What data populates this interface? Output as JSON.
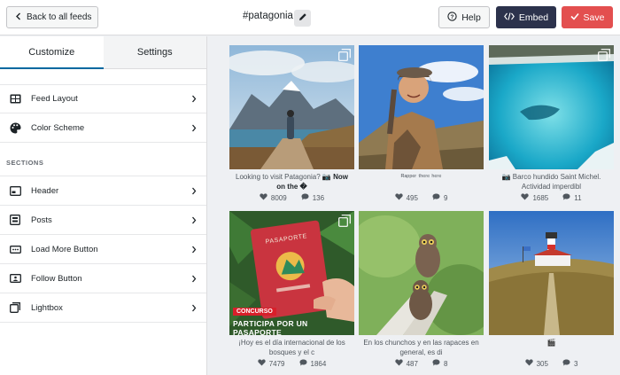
{
  "header": {
    "back_label": "Back to all feeds",
    "feed_title": "#patagonia",
    "help_label": "Help",
    "embed_label": "Embed",
    "save_label": "Save"
  },
  "sidebar": {
    "tabs": [
      {
        "label": "Customize",
        "active": true
      },
      {
        "label": "Settings",
        "active": false
      }
    ],
    "top_items": [
      {
        "label": "Feed Layout",
        "icon": "layout-icon"
      },
      {
        "label": "Color Scheme",
        "icon": "palette-icon"
      }
    ],
    "sections_label": "SECTIONS",
    "section_items": [
      {
        "label": "Header",
        "icon": "header-icon"
      },
      {
        "label": "Posts",
        "icon": "posts-icon"
      },
      {
        "label": "Load More Button",
        "icon": "load-more-icon"
      },
      {
        "label": "Follow Button",
        "icon": "follow-icon"
      },
      {
        "label": "Lightbox",
        "icon": "lightbox-icon"
      }
    ]
  },
  "posts": [
    {
      "caption": "Looking to visit Patagonia? 📷 ",
      "caption_bold": "Now on the �",
      "likes": "8009",
      "comments": "136"
    },
    {
      "caption": "ᴿᵃᵖᵖᵉʳ ᵗʰᵉʳᵉ ʰᵉʳᵉ",
      "caption_bold": "",
      "likes": "495",
      "comments": "9"
    },
    {
      "caption": "📷 Barco hundido Saint Michel. Actividad imperdibl",
      "caption_bold": "",
      "likes": "1685",
      "comments": "11"
    },
    {
      "caption": "¡Hoy es el día internacional de los bosques y el c",
      "caption_bold": "",
      "likes": "7479",
      "comments": "1864",
      "overlay_badge": "CONCURSO",
      "overlay_text": "PARTICIPA POR UN PASAPORTE",
      "passport_label": "PASAPORTE"
    },
    {
      "caption": "En los chunchos y en las rapaces en general, es di",
      "caption_bold": "",
      "likes": "487",
      "comments": "8"
    },
    {
      "caption": "🎬",
      "caption_bold": "",
      "likes": "305",
      "comments": "3"
    }
  ],
  "colors": {
    "accent": "#0068a0",
    "embed": "#2c324c",
    "save": "#e34f4f"
  }
}
